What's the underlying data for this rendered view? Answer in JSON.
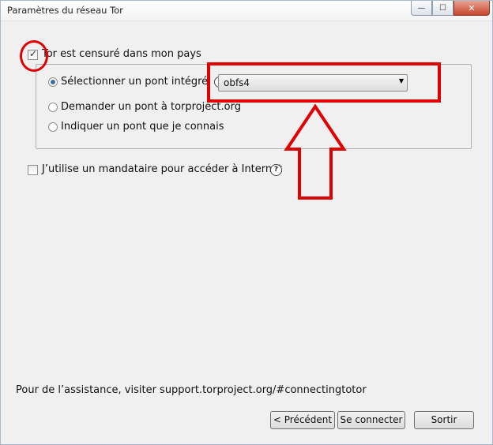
{
  "window": {
    "title": "Paramètres du réseau Tor",
    "controls": {
      "minimize": "—",
      "maximize": "☐",
      "close": "✕"
    }
  },
  "censored": {
    "checked": true,
    "label": "Tor est censuré dans mon pays"
  },
  "bridge_options": {
    "builtin": {
      "label": "Sélectionner un pont intégré",
      "selected": true
    },
    "request": {
      "label": "Demander un pont à torproject.org",
      "selected": false
    },
    "manual": {
      "label": "Indiquer un pont que je connais",
      "selected": false
    }
  },
  "bridge_select": {
    "value": "obfs4",
    "arrow": "▼"
  },
  "info_icon_glyph": "i",
  "proxy": {
    "checked": false,
    "label": "J’utilise un mandataire pour accéder à Internet",
    "help_glyph": "?"
  },
  "footer": {
    "assistance_text": "Pour de l’assistance, visiter support.torproject.org/#connectingtotor"
  },
  "buttons": {
    "previous": "< Précédent",
    "connect": "Se connecter",
    "quit": "Sortir"
  },
  "annotation_color": "#e00000"
}
